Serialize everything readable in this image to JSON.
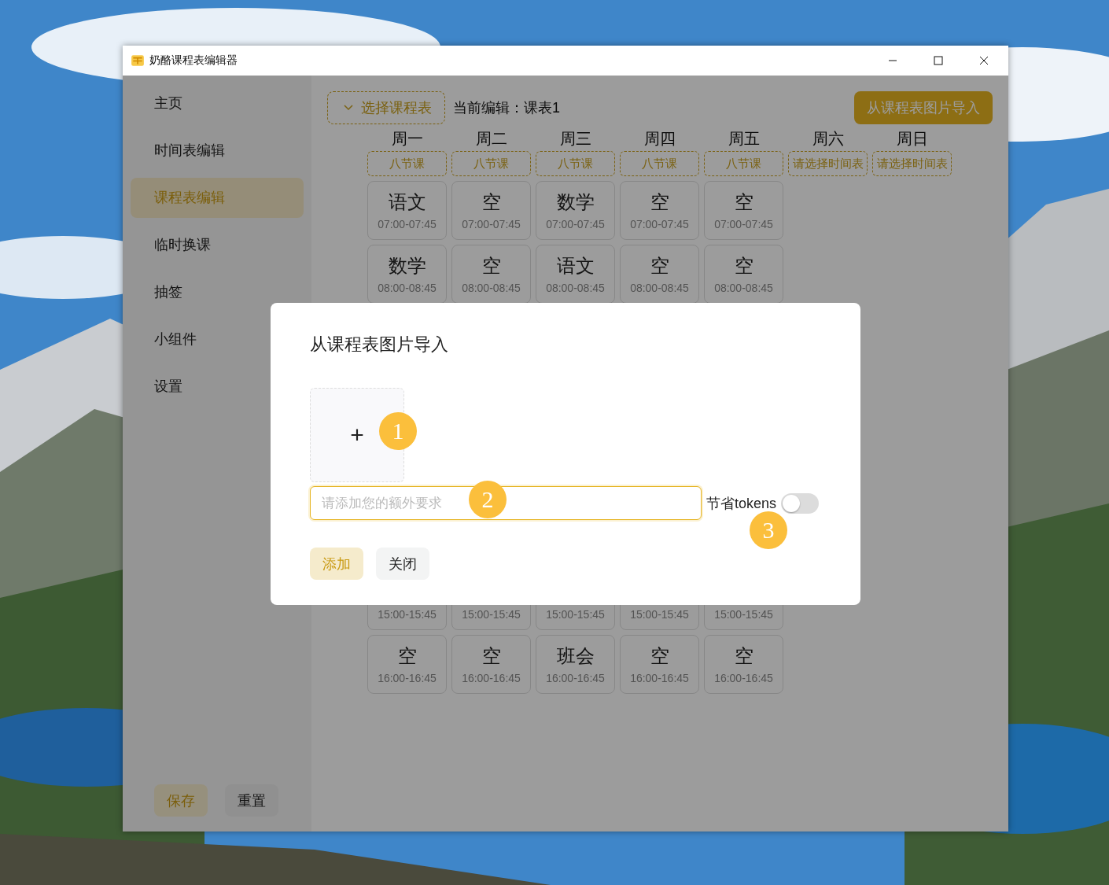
{
  "window": {
    "title": "奶酪课程表编辑器"
  },
  "sidebar": {
    "items": [
      {
        "label": "主页",
        "selected": false
      },
      {
        "label": "时间表编辑",
        "selected": false
      },
      {
        "label": "课程表编辑",
        "selected": true
      },
      {
        "label": "临时换课",
        "selected": false
      },
      {
        "label": "抽签",
        "selected": false
      },
      {
        "label": "小组件",
        "selected": false
      },
      {
        "label": "设置",
        "selected": false
      }
    ],
    "buttons": [
      {
        "label": "保存",
        "kind": "primary"
      },
      {
        "label": "重置",
        "kind": "plain"
      }
    ]
  },
  "toolbar": {
    "select_button": "选择课程表",
    "current_label": "当前编辑：课表1",
    "import_button": "从课程表图片导入"
  },
  "days": [
    {
      "label": "周一",
      "tag": "八节课"
    },
    {
      "label": "周二",
      "tag": "八节课"
    },
    {
      "label": "周三",
      "tag": "八节课"
    },
    {
      "label": "周四",
      "tag": "八节课"
    },
    {
      "label": "周五",
      "tag": "八节课"
    },
    {
      "label": "周六",
      "tag": "请选择时间表"
    },
    {
      "label": "周日",
      "tag": "请选择时间表"
    }
  ],
  "rows": [
    {
      "cells": [
        {
          "name": "语文",
          "time": "07:00-07:45"
        },
        {
          "name": "空",
          "time": "07:00-07:45"
        },
        {
          "name": "数学",
          "time": "07:00-07:45"
        },
        {
          "name": "空",
          "time": "07:00-07:45"
        },
        {
          "name": "空",
          "time": "07:00-07:45"
        }
      ]
    },
    {
      "cells": [
        {
          "name": "数学",
          "time": "08:00-08:45"
        },
        {
          "name": "空",
          "time": "08:00-08:45"
        },
        {
          "name": "语文",
          "time": "08:00-08:45"
        },
        {
          "name": "空",
          "time": "08:00-08:45"
        },
        {
          "name": "空",
          "time": "08:00-08:45"
        }
      ]
    },
    {
      "cells": [
        {
          "time": "15:00-15:45"
        },
        {
          "time": "15:00-15:45"
        },
        {
          "time": "15:00-15:45"
        },
        {
          "time": "15:00-15:45"
        },
        {
          "time": "15:00-15:45"
        }
      ]
    },
    {
      "cells": [
        {
          "name": "空",
          "time": "16:00-16:45"
        },
        {
          "name": "空",
          "time": "16:00-16:45"
        },
        {
          "name": "班会",
          "time": "16:00-16:45"
        },
        {
          "name": "空",
          "time": "16:00-16:45"
        },
        {
          "name": "空",
          "time": "16:00-16:45"
        }
      ]
    }
  ],
  "dialog": {
    "title": "从课程表图片导入",
    "upload_icon": "+",
    "input": {
      "placeholder": "请添加您的额外要求"
    },
    "save_tokens": {
      "label": "节省tokens",
      "on": false
    },
    "buttons": [
      {
        "label": "添加",
        "kind": "primary"
      },
      {
        "label": "关闭",
        "kind": "plain"
      }
    ]
  },
  "annotations": [
    {
      "label": "1"
    },
    {
      "label": "2"
    },
    {
      "label": "3"
    }
  ]
}
